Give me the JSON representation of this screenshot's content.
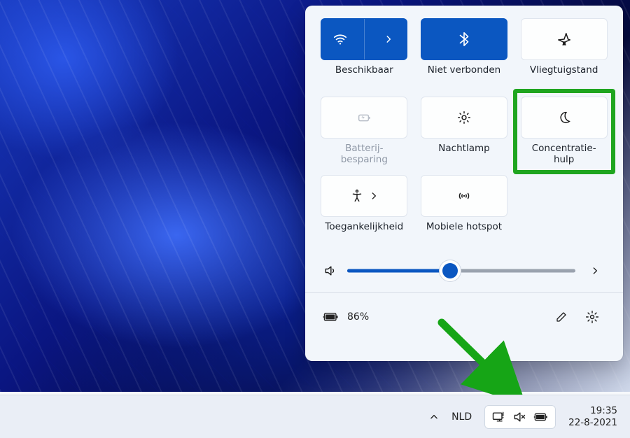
{
  "quick_settings": {
    "tiles": {
      "wifi": {
        "label": "Beschikbaar",
        "active": true
      },
      "bluetooth": {
        "label": "Niet verbonden",
        "active": true
      },
      "airplane": {
        "label": "Vliegtuigstand",
        "active": false
      },
      "battery_save": {
        "label": "Batterij-\nbesparing",
        "active": false,
        "disabled": true
      },
      "nightlight": {
        "label": "Nachtlamp",
        "active": false
      },
      "focus": {
        "label": "Concentratie-\nhulp",
        "active": false,
        "highlighted": true
      },
      "access": {
        "label": "Toegankelijkheid",
        "active": false
      },
      "hotspot": {
        "label": "Mobiele hotspot",
        "active": false
      }
    },
    "volume_percent": 45,
    "battery_text": "86%"
  },
  "taskbar": {
    "language": "NLD",
    "time": "19:35",
    "date": "22-8-2021"
  },
  "icons": {
    "wifi": "wifi-icon",
    "chevron": "chevron-right-icon",
    "bluetooth": "bluetooth-icon",
    "airplane": "airplane-icon",
    "battery": "battery-icon",
    "sun": "sun-icon",
    "moon": "moon-icon",
    "access": "accessibility-icon",
    "hotspot": "hotspot-icon",
    "speaker": "speaker-icon",
    "pencil": "pencil-icon",
    "gear": "gear-icon",
    "chevron_up": "chevron-up-icon",
    "monitor": "monitor-icon",
    "mute": "speaker-mute-icon",
    "plugged": "battery-plugged-icon"
  }
}
